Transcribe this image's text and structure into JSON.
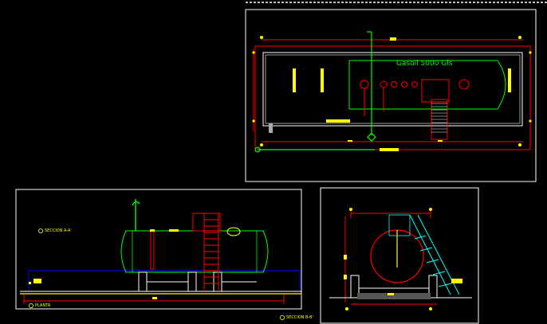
{
  "drawing": {
    "tank_title": "Gasoil 5000 Gls",
    "labels": {
      "seccion_aa": "SECCION A-A'",
      "planta": "PLANTA",
      "seccion_bb": "SECCION B-B'"
    }
  },
  "colors": {
    "background": "#000000",
    "frame": "#ffffff",
    "dimension": "#ff0000",
    "tank": "#00ff00",
    "accent": "#ffff00",
    "ground": "#0000ff",
    "ladder": "#ff0000",
    "support": "#00ffff"
  }
}
